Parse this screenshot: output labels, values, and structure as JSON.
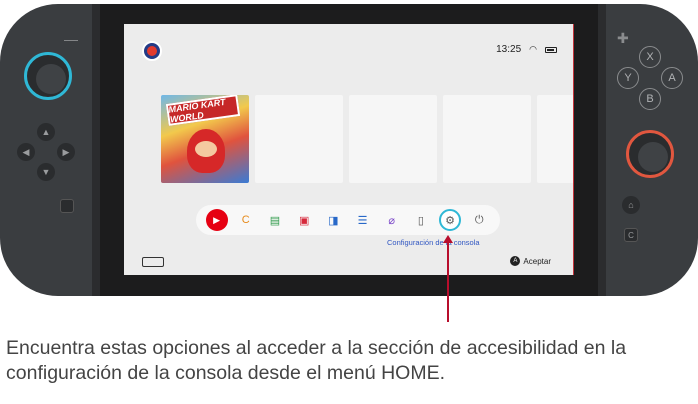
{
  "screen": {
    "status_time": "13:25",
    "game_title": "MARIO KART WORLD",
    "dock_caption": "Configuración de la consola",
    "accept_button": "A",
    "accept_label": "Aceptar",
    "dock_icons": [
      {
        "name": "nintendo-eshop-icon",
        "glyph": "▶"
      },
      {
        "name": "game-card-icon",
        "glyph": "C"
      },
      {
        "name": "news-icon",
        "glyph": "▤"
      },
      {
        "name": "shop-bag-icon",
        "glyph": "▣"
      },
      {
        "name": "album-icon",
        "glyph": "◨"
      },
      {
        "name": "chat-icon",
        "glyph": "☰"
      },
      {
        "name": "controllers-icon",
        "glyph": "⌀"
      },
      {
        "name": "virtual-card-icon",
        "glyph": "▯"
      },
      {
        "name": "settings-gear-icon",
        "glyph": "⚙"
      },
      {
        "name": "power-icon",
        "glyph": "⏻"
      }
    ]
  },
  "console": {
    "left_buttons": {
      "up": "▲",
      "down": "▼",
      "left": "◀",
      "right": "▶",
      "minus": "—"
    },
    "right_buttons": {
      "x": "X",
      "y": "Y",
      "a": "A",
      "b": "B",
      "plus": "✚",
      "home": "⌂",
      "c": "C"
    }
  },
  "caption": "Encuentra estas opciones al acceder a la sección de accesibilidad en la configuración de la consola desde el menú HOME.",
  "colors": {
    "left_stick": "#2fb8d6",
    "right_stick": "#e1573f",
    "pointer": "#b80e2c",
    "caption_link": "#3157c2"
  }
}
